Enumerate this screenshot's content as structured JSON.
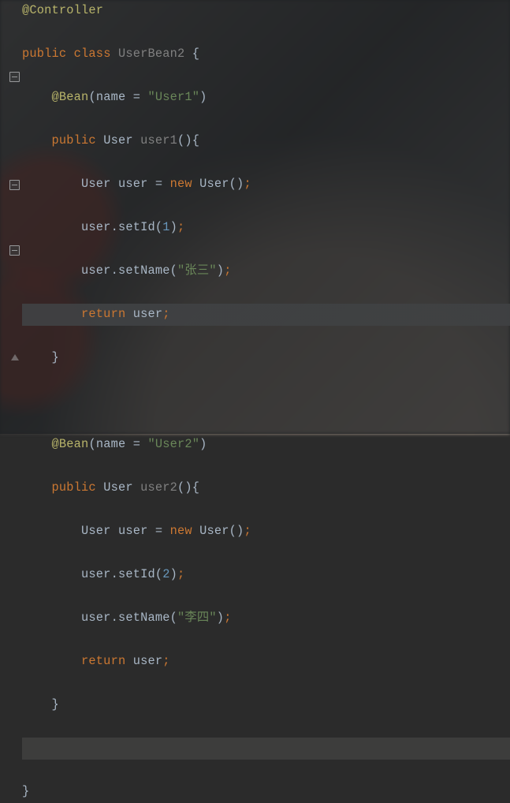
{
  "line_height": 27.5,
  "gutter_icons": [
    {
      "kind": "minus",
      "line": 3
    },
    {
      "kind": "minus",
      "line": 8
    },
    {
      "kind": "minus",
      "line": 11
    },
    {
      "kind": "tri",
      "line": 16
    }
  ],
  "lines": [
    {
      "highlight": "",
      "tokens": [
        {
          "cls": "tok-anno",
          "t": "@Controller"
        }
      ]
    },
    {
      "highlight": "",
      "tokens": [
        {
          "cls": "tok-kw",
          "t": "public "
        },
        {
          "cls": "tok-kw",
          "t": "class "
        },
        {
          "cls": "tok-dim",
          "t": "UserBean2 "
        },
        {
          "cls": "tok-punct",
          "t": "{"
        }
      ]
    },
    {
      "highlight": "",
      "indent": "    ",
      "tokens": [
        {
          "cls": "tok-anno",
          "t": "@Bean"
        },
        {
          "cls": "tok-punct",
          "t": "(name = "
        },
        {
          "cls": "tok-str",
          "t": "\"User1\""
        },
        {
          "cls": "tok-punct",
          "t": ")"
        }
      ]
    },
    {
      "highlight": "",
      "indent": "    ",
      "tokens": [
        {
          "cls": "tok-kw",
          "t": "public "
        },
        {
          "cls": "tok-type",
          "t": "User "
        },
        {
          "cls": "tok-dim",
          "t": "user1"
        },
        {
          "cls": "tok-punct",
          "t": "(){"
        }
      ]
    },
    {
      "highlight": "",
      "indent": "        ",
      "tokens": [
        {
          "cls": "tok-type",
          "t": "User "
        },
        {
          "cls": "tok-ident",
          "t": "user "
        },
        {
          "cls": "tok-punct",
          "t": "= "
        },
        {
          "cls": "tok-kw",
          "t": "new "
        },
        {
          "cls": "tok-type",
          "t": "User()"
        },
        {
          "cls": "tok-semi",
          "t": ";"
        }
      ]
    },
    {
      "highlight": "",
      "indent": "        ",
      "tokens": [
        {
          "cls": "tok-ident",
          "t": "user"
        },
        {
          "cls": "tok-punct",
          "t": "."
        },
        {
          "cls": "tok-ident",
          "t": "setId"
        },
        {
          "cls": "tok-punct",
          "t": "("
        },
        {
          "cls": "tok-num",
          "t": "1"
        },
        {
          "cls": "tok-punct",
          "t": ")"
        },
        {
          "cls": "tok-semi",
          "t": ";"
        }
      ]
    },
    {
      "highlight": "",
      "indent": "        ",
      "tokens": [
        {
          "cls": "tok-ident",
          "t": "user"
        },
        {
          "cls": "tok-punct",
          "t": "."
        },
        {
          "cls": "tok-ident",
          "t": "setName"
        },
        {
          "cls": "tok-punct",
          "t": "("
        },
        {
          "cls": "tok-str",
          "t": "\"张三\""
        },
        {
          "cls": "tok-punct",
          "t": ")"
        },
        {
          "cls": "tok-semi",
          "t": ";"
        }
      ]
    },
    {
      "highlight": "hl",
      "indent": "        ",
      "tokens": [
        {
          "cls": "tok-kw",
          "t": "return "
        },
        {
          "cls": "tok-ident",
          "t": "user"
        },
        {
          "cls": "tok-semi",
          "t": ";"
        }
      ]
    },
    {
      "highlight": "",
      "indent": "    ",
      "tokens": [
        {
          "cls": "tok-punct",
          "t": "}"
        }
      ]
    },
    {
      "highlight": "",
      "tokens": []
    },
    {
      "highlight": "",
      "indent": "    ",
      "tokens": [
        {
          "cls": "tok-anno",
          "t": "@Bean"
        },
        {
          "cls": "tok-punct",
          "t": "(name = "
        },
        {
          "cls": "tok-str",
          "t": "\"User2\""
        },
        {
          "cls": "tok-punct",
          "t": ")"
        }
      ]
    },
    {
      "highlight": "",
      "indent": "    ",
      "tokens": [
        {
          "cls": "tok-kw",
          "t": "public "
        },
        {
          "cls": "tok-type",
          "t": "User "
        },
        {
          "cls": "tok-dim",
          "t": "user2"
        },
        {
          "cls": "tok-punct",
          "t": "(){"
        }
      ]
    },
    {
      "highlight": "",
      "indent": "        ",
      "tokens": [
        {
          "cls": "tok-type",
          "t": "User "
        },
        {
          "cls": "tok-ident",
          "t": "user "
        },
        {
          "cls": "tok-punct",
          "t": "= "
        },
        {
          "cls": "tok-kw",
          "t": "new "
        },
        {
          "cls": "tok-type",
          "t": "User()"
        },
        {
          "cls": "tok-semi",
          "t": ";"
        }
      ]
    },
    {
      "highlight": "",
      "indent": "        ",
      "tokens": [
        {
          "cls": "tok-ident",
          "t": "user"
        },
        {
          "cls": "tok-punct",
          "t": "."
        },
        {
          "cls": "tok-ident",
          "t": "setId"
        },
        {
          "cls": "tok-punct",
          "t": "("
        },
        {
          "cls": "tok-num",
          "t": "2"
        },
        {
          "cls": "tok-punct",
          "t": ")"
        },
        {
          "cls": "tok-semi",
          "t": ";"
        }
      ]
    },
    {
      "highlight": "",
      "indent": "        ",
      "tokens": [
        {
          "cls": "tok-ident",
          "t": "user"
        },
        {
          "cls": "tok-punct",
          "t": "."
        },
        {
          "cls": "tok-ident",
          "t": "setName"
        },
        {
          "cls": "tok-punct",
          "t": "("
        },
        {
          "cls": "tok-str",
          "t": "\"李四\""
        },
        {
          "cls": "tok-punct",
          "t": ")"
        },
        {
          "cls": "tok-semi",
          "t": ";"
        }
      ]
    },
    {
      "highlight": "",
      "indent": "        ",
      "tokens": [
        {
          "cls": "tok-kw",
          "t": "return "
        },
        {
          "cls": "tok-ident",
          "t": "user"
        },
        {
          "cls": "tok-semi",
          "t": ";"
        }
      ]
    },
    {
      "highlight": "",
      "indent": "    ",
      "tokens": [
        {
          "cls": "tok-punct",
          "t": "}"
        }
      ]
    },
    {
      "highlight": "hl2",
      "tokens": []
    },
    {
      "highlight": "",
      "tokens": [
        {
          "cls": "tok-punct",
          "t": "}"
        }
      ]
    }
  ]
}
